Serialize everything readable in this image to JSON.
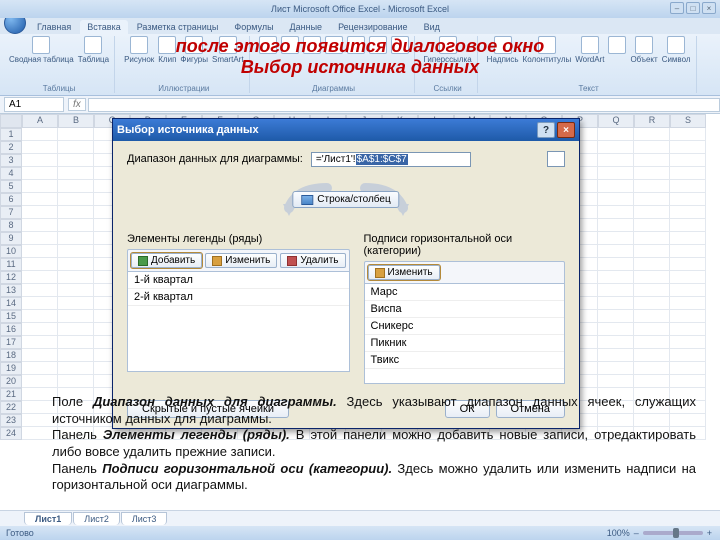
{
  "app": {
    "title": "Лист Microsoft Office Excel - Microsoft Excel",
    "win_min": "–",
    "win_max": "□",
    "win_close": "×"
  },
  "ribbon": {
    "tabs": [
      "Главная",
      "Вставка",
      "Разметка страницы",
      "Формулы",
      "Данные",
      "Рецензирование",
      "Вид"
    ],
    "active_tab": "Вставка",
    "groups": {
      "tables": {
        "label": "Таблицы",
        "items": [
          "Сводная таблица",
          "Таблица"
        ]
      },
      "illustr": {
        "label": "Иллюстрации",
        "items": [
          "Рисунок",
          "Клип",
          "Фигуры",
          "SmartArt"
        ]
      },
      "charts": {
        "label": "Диаграммы",
        "items": [
          "Гистограмма",
          "График",
          "Круговая",
          "Линейчатая",
          "С областями",
          "Точечная",
          "Другие диаграммы"
        ]
      },
      "links": {
        "label": "Ссылки",
        "items": [
          "Гиперссылка"
        ]
      },
      "text": {
        "label": "Текст",
        "items": [
          "Надпись",
          "Колонтитулы",
          "WordArt",
          "Строка подписи",
          "Объект",
          "Символ"
        ]
      }
    }
  },
  "annotation": {
    "line1": "после этого появится диалоговое окно",
    "line2": "Выбор источника данных"
  },
  "formula": {
    "namebox": "A1",
    "fx": "fx"
  },
  "sheet": {
    "cols": [
      "A",
      "B",
      "C",
      "D",
      "E",
      "F",
      "G",
      "H",
      "I",
      "J",
      "K",
      "L",
      "M",
      "N",
      "O",
      "P",
      "Q",
      "R",
      "S"
    ],
    "rows": 24,
    "tabs": [
      "Лист1",
      "Лист2",
      "Лист3"
    ]
  },
  "dialog": {
    "title": "Выбор источника данных",
    "help": "?",
    "close": "×",
    "range_label": "Диапазон данных для диаграммы:",
    "range_value_prefix": "='Лист1'!",
    "range_value_hl": "$A$1:$C$7",
    "swap_btn": "Строка/столбец",
    "legend_title": "Элементы легенды (ряды)",
    "legend_buttons": {
      "add": "Добавить",
      "edit": "Изменить",
      "delete": "Удалить"
    },
    "legend_items": [
      "1-й квартал",
      "2-й квартал"
    ],
    "axis_title": "Подписи горизонтальной оси (категории)",
    "axis_buttons": {
      "edit": "Изменить"
    },
    "axis_items": [
      "Марс",
      "Виспа",
      "Сникерс",
      "Пикник",
      "Твикс"
    ],
    "hidden_btn": "Скрытые и пустые ячейки",
    "ok": "ОК",
    "cancel": "Отмена"
  },
  "explain": {
    "p1a": "Поле ",
    "p1b": "Диапазон данных для диаграммы.",
    "p1c": " Здесь указывают диапазон данных ячеек, служащих источником данных для диаграммы.",
    "p2a": "Панель ",
    "p2b": "Элементы легенды (ряды).",
    "p2c": " В этой панели можно добавить новые записи, отредактировать либо вовсе удалить прежние записи.",
    "p3a": "Панель ",
    "p3b": "Подписи горизонтальной оси (категории).",
    "p3c": " Здесь можно удалить или изменить надписи на горизонтальной оси диаграммы."
  },
  "status": {
    "ready": "Готово",
    "zoom": "100%"
  }
}
